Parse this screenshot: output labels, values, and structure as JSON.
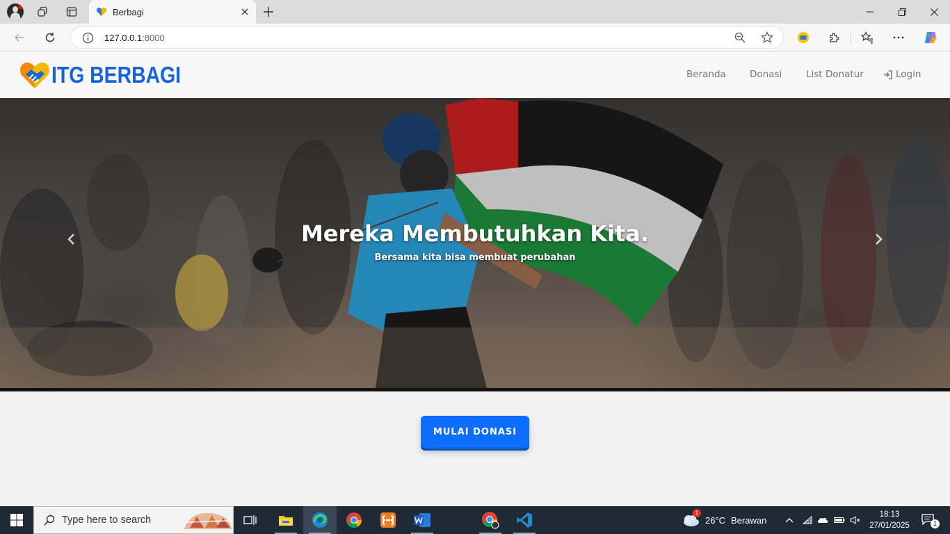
{
  "browser": {
    "tab_title": "Berbagi",
    "url_host": "127.0.0.1",
    "url_port": ":8000"
  },
  "site": {
    "brand": "ITG BERBAGI",
    "nav": [
      "Beranda",
      "Donasi",
      "List Donatur"
    ],
    "login": "Login"
  },
  "hero": {
    "heading": "Mereka Membutuhkan Kita.",
    "subheading": "Bersama kita bisa membuat perubahan"
  },
  "cta": {
    "label": "MULAI DONASI"
  },
  "taskbar": {
    "search_placeholder": "Type here to search",
    "weather_temp": "26°C",
    "weather_desc": "Berawan",
    "weather_badge": "1",
    "time": "18:13",
    "date": "27/01/2025",
    "notifications": "1"
  },
  "colors": {
    "brand_blue": "#1565d8",
    "button_blue": "#0d6efd",
    "taskbar": "#202936"
  }
}
